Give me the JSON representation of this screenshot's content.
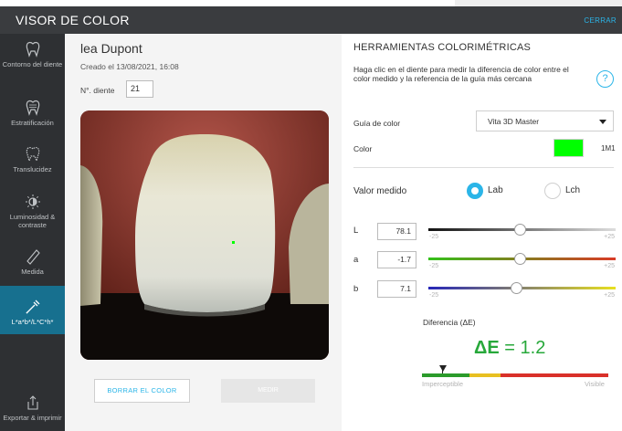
{
  "window": {
    "title": "VISOR DE COLOR",
    "close_label": "CERRAR"
  },
  "sidebar": {
    "items": [
      {
        "label": "Contorno del diente",
        "icon": "tooth-outline-icon"
      },
      {
        "label": "Estratificación",
        "icon": "tooth-layers-icon"
      },
      {
        "label": "Translucidez",
        "icon": "tooth-translucency-icon"
      },
      {
        "label": "Luminosidad & contraste",
        "icon": "brightness-icon"
      },
      {
        "label": "Medida",
        "icon": "ruler-icon"
      },
      {
        "label": "L*a*b*/L*C*h*",
        "icon": "color-picker-icon",
        "active": true
      },
      {
        "label": "Exportar & imprimir",
        "icon": "export-icon"
      }
    ]
  },
  "patient": {
    "name": "lea Dupont",
    "created": "Creado el 13/08/2021, 16:08",
    "tooth_label": "N°. diente",
    "tooth_number": "21"
  },
  "buttons": {
    "clear_color": "BORRAR EL COLOR",
    "measure": "MEDIR"
  },
  "tools": {
    "title": "HERRAMIENTAS COLORIMÉTRICAS",
    "instructions": "Haga clic en el diente para medir la diferencia de color entre el color medido y la referencia de la guía más cercana",
    "help_symbol": "?",
    "guide_label": "Guía de color",
    "guide_value": "Vita 3D Master",
    "color_label": "Color",
    "swatch_color": "#00ff00",
    "shade_code": "1M1",
    "measured_label": "Valor medido",
    "mode_lab": "Lab",
    "mode_lch": "Lch",
    "selected_mode": "Lab"
  },
  "sliders": [
    {
      "label": "L",
      "value": "78.1",
      "min": "-25",
      "max": "+25",
      "level": 0.49,
      "gradient": [
        "#111111",
        "#dddddd"
      ]
    },
    {
      "label": "a",
      "value": "-1.7",
      "min": "-25",
      "max": "+25",
      "level": 0.49,
      "gradient": [
        "#33c11a",
        "#d93a26"
      ]
    },
    {
      "label": "b",
      "value": "7.1",
      "min": "-25",
      "max": "+25",
      "level": 0.47,
      "gradient": [
        "#2626b8",
        "#e8e020"
      ]
    }
  ],
  "difference": {
    "label": "Diferencia (ΔE)",
    "delta_symbol": "ΔE",
    "delta_text": " = 1.2",
    "value": 1.2,
    "scale_low": "Imperceptible",
    "scale_high": "Visible",
    "scale_colors": [
      "#2b9b2b",
      "#e8c021",
      "#d9302a"
    ]
  }
}
